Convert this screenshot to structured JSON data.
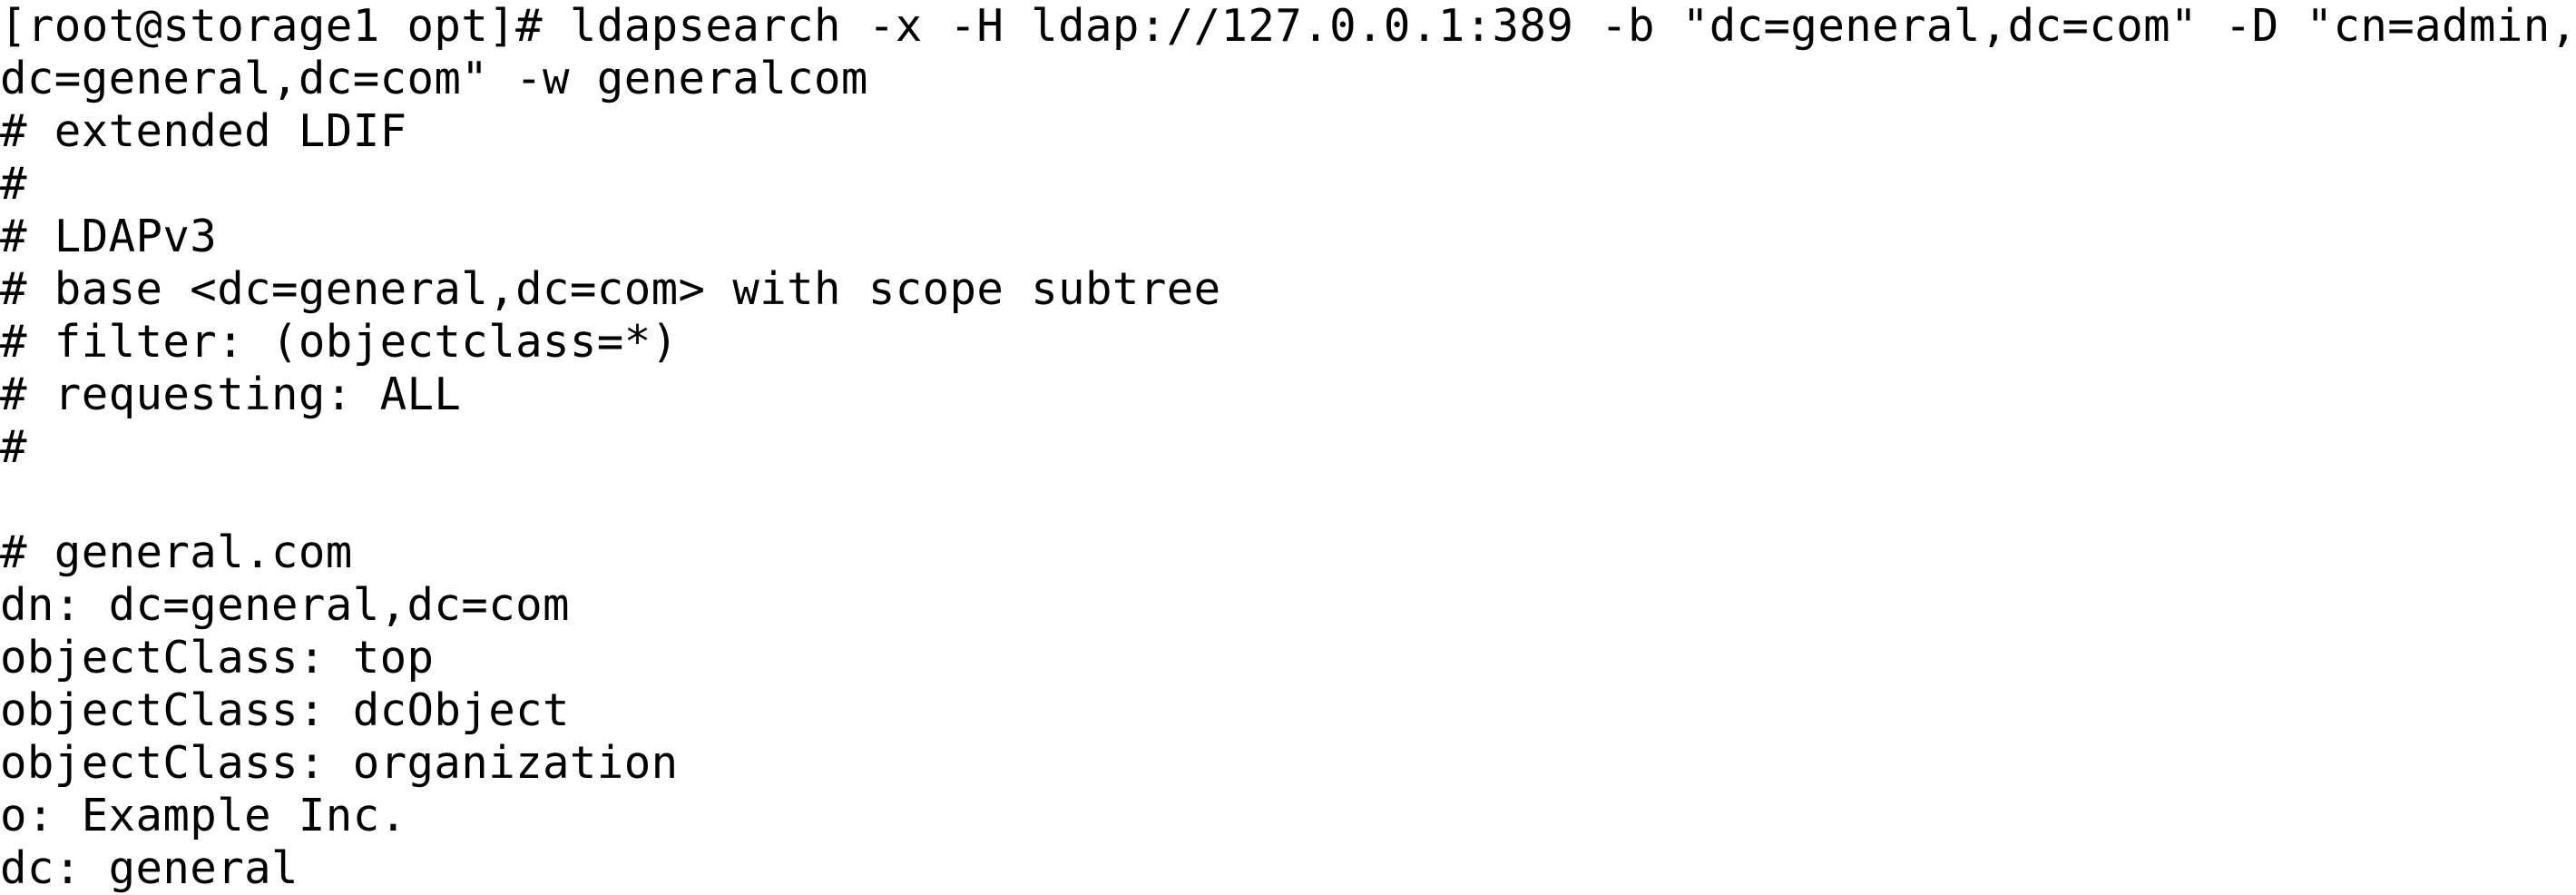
{
  "terminal": {
    "lines": [
      "[root@storage1 opt]# ldapsearch -x -H ldap://127.0.0.1:389 -b \"dc=general,dc=com\" -D \"cn=admin,",
      "dc=general,dc=com\" -w generalcom",
      "# extended LDIF",
      "#",
      "# LDAPv3",
      "# base <dc=general,dc=com> with scope subtree",
      "# filter: (objectclass=*)",
      "# requesting: ALL",
      "#",
      "",
      "# general.com",
      "dn: dc=general,dc=com",
      "objectClass: top",
      "objectClass: dcObject",
      "objectClass: organization",
      "o: Example Inc.",
      "dc: general"
    ]
  }
}
